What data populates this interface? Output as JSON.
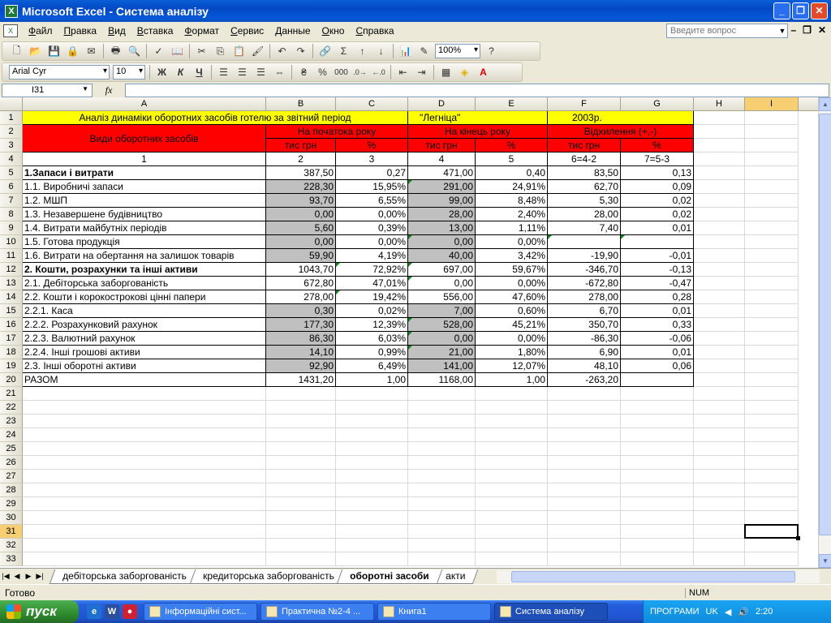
{
  "window": {
    "title": "Microsoft Excel - Система аналізу",
    "app_icon": "excel-icon"
  },
  "menu": [
    "Файл",
    "Правка",
    "Вид",
    "Вставка",
    "Формат",
    "Сервис",
    "Данные",
    "Окно",
    "Справка"
  ],
  "ask_placeholder": "Введите вопрос",
  "toolbar": {
    "zoom": "100%",
    "font_name": "Arial Cyr",
    "font_size": "10",
    "bold": "Ж",
    "italic": "К",
    "underline": "Ч",
    "percent": "%",
    "thousands": "000",
    "sigma": "Σ"
  },
  "formula_bar": {
    "name_box": "I31",
    "fx": "fx",
    "value": ""
  },
  "columns": [
    "A",
    "B",
    "C",
    "D",
    "E",
    "F",
    "G",
    "H",
    "I"
  ],
  "rows": [
    "1",
    "2",
    "3",
    "4",
    "5",
    "6",
    "7",
    "8",
    "9",
    "10",
    "11",
    "12",
    "13",
    "14",
    "15",
    "16",
    "17",
    "18",
    "19",
    "20",
    "21",
    "22",
    "23",
    "24",
    "25",
    "26",
    "27",
    "28",
    "29",
    "30",
    "31",
    "32",
    "33"
  ],
  "sheet": {
    "title_a": "Аналіз динаміки оборотних засобів готелю за звітний період",
    "title_d": "\"Легніца\"",
    "title_f": "2003р.",
    "hdr_kinds": "Види оборотних засобів",
    "hdr_start": "На початока року",
    "hdr_end": "На кінець року",
    "hdr_dev": "Відхилення (+,-)",
    "unit_th": "тис грн",
    "unit_pct": "%",
    "colnums": [
      "1",
      "2",
      "3",
      "4",
      "5",
      "6=4-2",
      "7=5-3"
    ],
    "data": [
      [
        "1.Запаси і витрати",
        "387,50",
        "0,27",
        "471,00",
        "0,40",
        "83,50",
        "0,13"
      ],
      [
        "1.1. Виробничі запаси",
        "228,30",
        "15,95%",
        "291,00",
        "24,91%",
        "62,70",
        "0,09"
      ],
      [
        "1.2. МШП",
        "93,70",
        "6,55%",
        "99,00",
        "8,48%",
        "5,30",
        "0,02"
      ],
      [
        "1.3. Незавершене будівництво",
        "0,00",
        "0,00%",
        "28,00",
        "2,40%",
        "28,00",
        "0,02"
      ],
      [
        "1.4. Витрати майбутніх періодів",
        "5,60",
        "0,39%",
        "13,00",
        "1,11%",
        "7,40",
        "0,01"
      ],
      [
        "1.5. Готова продукція",
        "0,00",
        "0,00%",
        "0,00",
        "0,00%",
        "",
        ""
      ],
      [
        "1.6. Витрати на обертання на залишок товарів",
        "59,90",
        "4,19%",
        "40,00",
        "3,42%",
        "-19,90",
        "-0,01"
      ],
      [
        "2. Кошти, розрахунки та інші активи",
        "1043,70",
        "72,92%",
        "697,00",
        "59,67%",
        "-346,70",
        "-0,13"
      ],
      [
        "2.1. Дебіторська заборгованість",
        "672,80",
        "47,01%",
        "0,00",
        "0,00%",
        "-672,80",
        "-0,47"
      ],
      [
        "2.2. Кошти і корокостроковi цінні папери",
        "278,00",
        "19,42%",
        "556,00",
        "47,60%",
        "278,00",
        "0,28"
      ],
      [
        "2.2.1. Каса",
        "0,30",
        "0,02%",
        "7,00",
        "0,60%",
        "6,70",
        "0,01"
      ],
      [
        "2.2.2. Розрахунковий рахунок",
        "177,30",
        "12,39%",
        "528,00",
        "45,21%",
        "350,70",
        "0,33"
      ],
      [
        "2.2.3. Валютний рахунок",
        "86,30",
        "6,03%",
        "0,00",
        "0,00%",
        "-86,30",
        "-0,06"
      ],
      [
        "2.2.4. Інші грошові активи",
        "14,10",
        "0,99%",
        "21,00",
        "1,80%",
        "6,90",
        "0,01"
      ],
      [
        "2.3. Інші оборотні активи",
        "92,90",
        "6,49%",
        "141,00",
        "12,07%",
        "48,10",
        "0,06"
      ],
      [
        "РАЗОМ",
        "1431,20",
        "1,00",
        "1168,00",
        "1,00",
        "-263,20",
        ""
      ]
    ]
  },
  "tabs": [
    "дебіторська заборгованість",
    "кредиторська заборгованість",
    "оборотні засоби",
    "акти"
  ],
  "status": {
    "ready": "Готово",
    "num": "NUM"
  },
  "taskbar": {
    "start": "пуск",
    "buttons": [
      "Інформаційні сист...",
      "Практична №2-4 ...",
      "Книга1",
      "Система аналізу"
    ],
    "lang_label": "ПРОГРАМИ",
    "lang": "UK",
    "time": "2:20"
  }
}
